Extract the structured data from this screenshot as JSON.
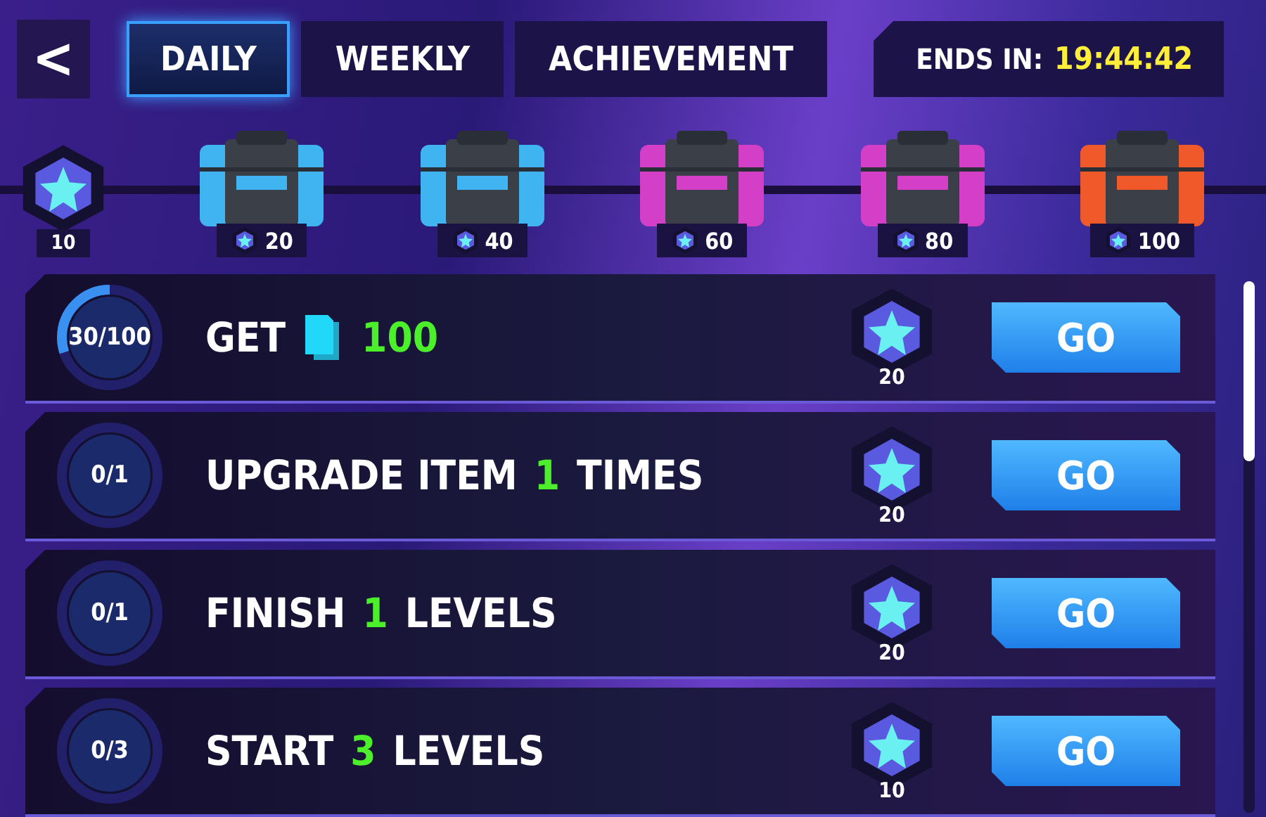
{
  "back_button": {
    "label": "<"
  },
  "tabs": [
    {
      "label": "DAILY",
      "selected": true
    },
    {
      "label": "WEEKLY",
      "selected": false
    },
    {
      "label": "ACHIEVEMENT",
      "selected": false
    }
  ],
  "timer": {
    "label": "ENDS IN:",
    "value": "19:44:42"
  },
  "progress": {
    "points": "10"
  },
  "chests": [
    {
      "points": "20",
      "color": "#3fb4f0"
    },
    {
      "points": "40",
      "color": "#3fb4f0"
    },
    {
      "points": "60",
      "color": "#d43fc8"
    },
    {
      "points": "80",
      "color": "#d43fc8"
    },
    {
      "points": "100",
      "color": "#f0592a"
    }
  ],
  "quests": [
    {
      "progress": "30/100",
      "level": 0.3,
      "segments": [
        {
          "kind": "text",
          "text": "GET"
        },
        {
          "kind": "cards-icon"
        },
        {
          "kind": "count",
          "text": "100"
        }
      ],
      "reward": "20",
      "button": "GO"
    },
    {
      "progress": "0/1",
      "level": 0,
      "segments": [
        {
          "kind": "text",
          "text": "UPGRADE ITEM"
        },
        {
          "kind": "count",
          "text": "1"
        },
        {
          "kind": "text",
          "text": "TIMES"
        }
      ],
      "reward": "20",
      "button": "GO"
    },
    {
      "progress": "0/1",
      "level": 0,
      "segments": [
        {
          "kind": "text",
          "text": "FINISH"
        },
        {
          "kind": "count",
          "text": "1"
        },
        {
          "kind": "text",
          "text": "LEVELS"
        }
      ],
      "reward": "20",
      "button": "GO"
    },
    {
      "progress": "0/3",
      "level": 0,
      "segments": [
        {
          "kind": "text",
          "text": "START"
        },
        {
          "kind": "count",
          "text": "3"
        },
        {
          "kind": "text",
          "text": "LEVELS"
        }
      ],
      "reward": "10",
      "button": "GO"
    }
  ]
}
